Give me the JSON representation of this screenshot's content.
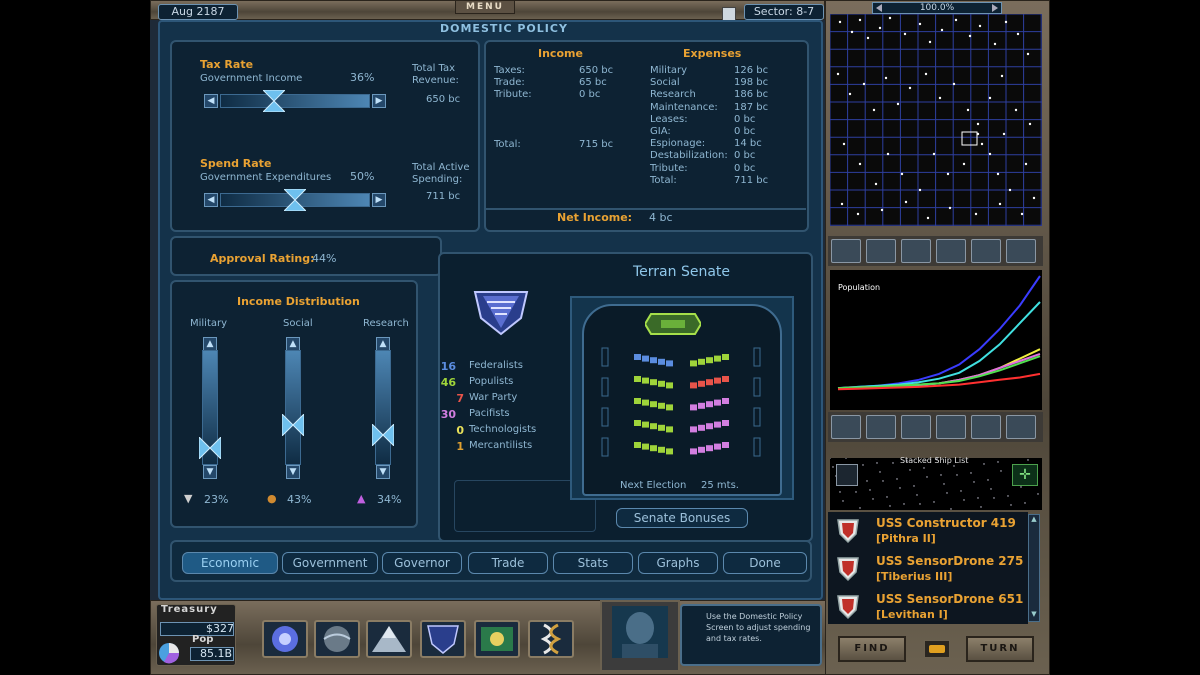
{
  "top_bar": {
    "date": "Aug 2187",
    "menu_label": "MENU",
    "sector": "Sector: 8-7"
  },
  "minimap": {
    "zoom": "100.0%"
  },
  "domestic_policy": {
    "title": "DOMESTIC POLICY",
    "tax_rate": {
      "title": "Tax Rate",
      "subtitle": "Government Income",
      "percent": "36%",
      "total_label_1": "Total Tax",
      "total_label_2": "Revenue:",
      "total_value": "650 bc",
      "level": 0.36
    },
    "spend_rate": {
      "title": "Spend Rate",
      "subtitle": "Government Expenditures",
      "percent": "50%",
      "total_label_1": "Total Active",
      "total_label_2": "Spending:",
      "total_value": "711 bc",
      "level": 0.5
    },
    "approval": {
      "label": "Approval Rating:",
      "value": "44%"
    }
  },
  "income": {
    "title": "Income",
    "rows": [
      {
        "label": "Taxes:",
        "value": "650 bc"
      },
      {
        "label": "Trade:",
        "value": "65 bc"
      },
      {
        "label": "Tribute:",
        "value": "0 bc"
      }
    ],
    "total_label": "Total:",
    "total_value": "715 bc"
  },
  "expenses": {
    "title": "Expenses",
    "rows": [
      {
        "label": "Military",
        "value": "126 bc"
      },
      {
        "label": "Social",
        "value": "198 bc"
      },
      {
        "label": "Research",
        "value": "186 bc"
      },
      {
        "label": "Maintenance:",
        "value": "187 bc"
      },
      {
        "label": "Leases:",
        "value": "0 bc"
      },
      {
        "label": "GIA:",
        "value": "0 bc"
      },
      {
        "label": "Espionage:",
        "value": "14 bc"
      },
      {
        "label": "Destabilization:",
        "value": "0 bc"
      },
      {
        "label": "Tribute:",
        "value": "0 bc"
      },
      {
        "label": "Total:",
        "value": "711 bc"
      }
    ]
  },
  "net_income": {
    "label": "Net Income:",
    "value": "4 bc"
  },
  "income_distribution": {
    "title": "Income Distribution",
    "columns": [
      {
        "label": "Military",
        "percent": "23%",
        "level": 0.23
      },
      {
        "label": "Social",
        "percent": "43%",
        "level": 0.43
      },
      {
        "label": "Research",
        "percent": "34%",
        "level": 0.34
      }
    ]
  },
  "senate": {
    "title": "Terran Senate",
    "parties": [
      {
        "count": "16",
        "name": "Federalists",
        "color": "#5b8de0"
      },
      {
        "count": "46",
        "name": "Populists",
        "color": "#9fd43a"
      },
      {
        "count": "7",
        "name": "War Party",
        "color": "#e8544a"
      },
      {
        "count": "30",
        "name": "Pacifists",
        "color": "#d27ee0"
      },
      {
        "count": "0",
        "name": "Technologists",
        "color": "#e8e05a"
      },
      {
        "count": "1",
        "name": "Mercantilists",
        "color": "#e0a030"
      }
    ],
    "next_election_label": "Next Election",
    "next_election_value": "25 mts.",
    "bonuses_label": "Senate Bonuses"
  },
  "tabs": [
    "Economic",
    "Government",
    "Governor",
    "Trade",
    "Stats",
    "Graphs",
    "Done"
  ],
  "treasury": {
    "title": "Treasury",
    "money": "$327",
    "pop_label": "Pop",
    "pop_value": "85.1B"
  },
  "help_text": "Use the Domestic Policy Screen to adjust spending and tax rates.",
  "graph": {
    "title": "Population"
  },
  "chart_data": {
    "type": "line",
    "title": "Population",
    "series": [
      {
        "color": "#3a3cff",
        "values": [
          0.05,
          0.06,
          0.07,
          0.09,
          0.12,
          0.17,
          0.25,
          0.38,
          0.55,
          0.75,
          1.0
        ]
      },
      {
        "color": "#40e0e0",
        "values": [
          0.05,
          0.06,
          0.07,
          0.08,
          0.1,
          0.13,
          0.18,
          0.28,
          0.42,
          0.6,
          0.78
        ]
      },
      {
        "color": "#f0f040",
        "values": [
          0.05,
          0.055,
          0.06,
          0.07,
          0.08,
          0.09,
          0.12,
          0.16,
          0.22,
          0.3,
          0.38
        ]
      },
      {
        "color": "#e070e0",
        "values": [
          0.05,
          0.055,
          0.06,
          0.065,
          0.075,
          0.09,
          0.12,
          0.16,
          0.22,
          0.28,
          0.34
        ]
      },
      {
        "color": "#50e050",
        "values": [
          0.05,
          0.055,
          0.06,
          0.07,
          0.08,
          0.09,
          0.11,
          0.15,
          0.2,
          0.26,
          0.32
        ]
      },
      {
        "color": "#ff3030",
        "values": [
          0.04,
          0.045,
          0.05,
          0.055,
          0.06,
          0.07,
          0.08,
          0.1,
          0.12,
          0.14,
          0.17
        ]
      }
    ]
  },
  "ship_list": {
    "title": "Stacked Ship List",
    "ships": [
      {
        "name": "USS Constructor 419",
        "location": "[Pithra II]"
      },
      {
        "name": "USS SensorDrone 275",
        "location": "[Tiberius III]"
      },
      {
        "name": "USS SensorDrone 651",
        "location": "[Levithan I]"
      }
    ]
  },
  "bottom_buttons": {
    "find": "FIND",
    "turn": "TURN"
  }
}
